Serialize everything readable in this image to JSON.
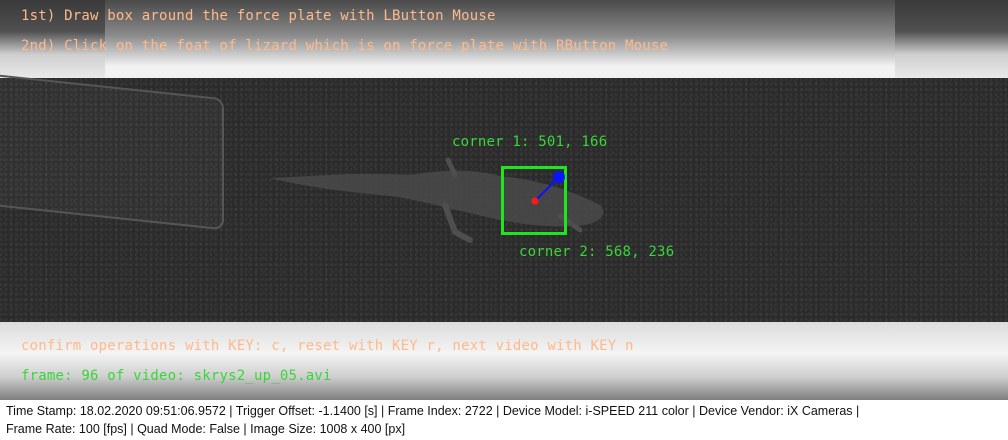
{
  "overlay": {
    "instruction_1": "1st) Draw box around the force plate with LButton Mouse",
    "instruction_2": "2nd) Click on the foat of lizard which is on force plate with RButton Mouse",
    "corner_1_label": "corner 1: 501, 166",
    "corner_2_label": "corner 2: 568, 236",
    "confirm_text": "confirm operations with KEY: c, reset with KEY r, next video with KEY n",
    "frame_text": "frame: 96 of video: skrys2_up_05.avi"
  },
  "status_bar": {
    "line_1": "Time Stamp: 18.02.2020 09:51:06.9572  |  Trigger Offset: -1.1400 [s]  |  Frame Index: 2722  |  Device Model: i-SPEED 211 color  |  Device Vendor: iX Cameras  |",
    "line_2": "Frame Rate: 100 [fps]  |  Quad Mode: False  |  Image Size: 1008 x 400 [px]"
  },
  "colors": {
    "overlay_text_orange": "#ffb98a",
    "overlay_text_green": "#39d639",
    "box_green": "#1ee61e",
    "marker_blue": "#0a14ff",
    "marker_red": "#ff1a1a"
  }
}
